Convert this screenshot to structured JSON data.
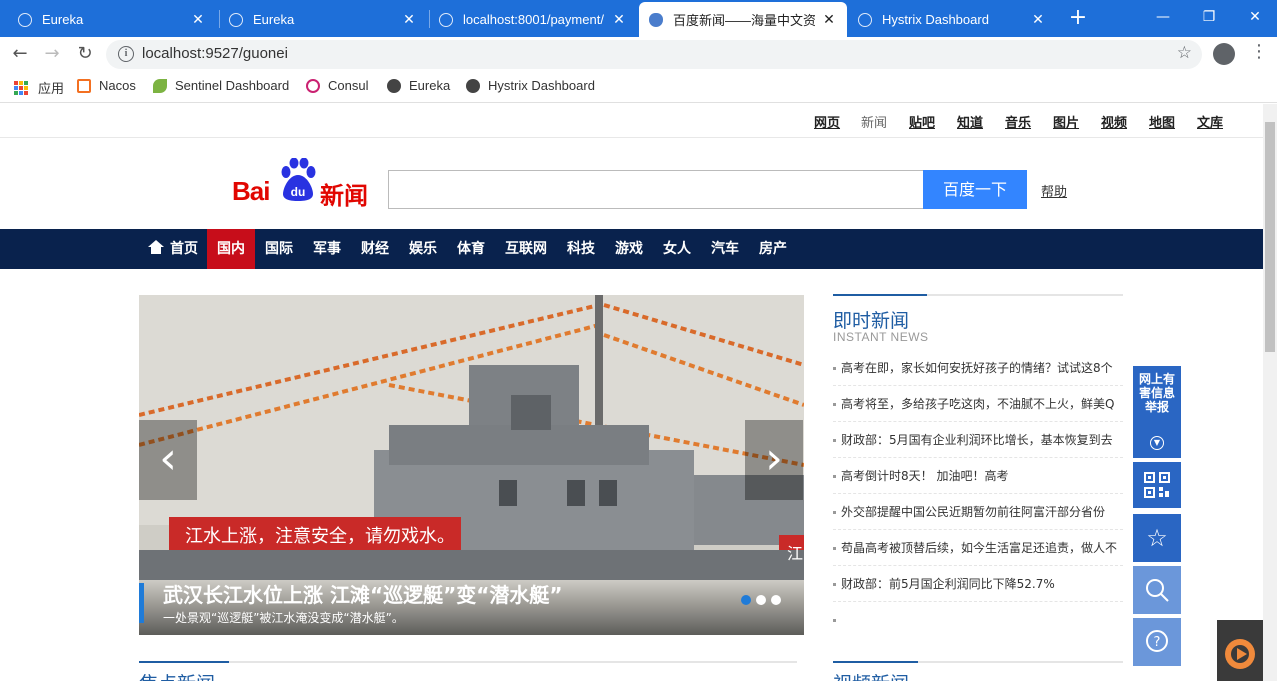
{
  "browser": {
    "tabs": [
      {
        "title": "Eureka",
        "active": false
      },
      {
        "title": "Eureka",
        "active": false
      },
      {
        "title": "localhost:8001/payment/",
        "active": false
      },
      {
        "title": "百度新闻——海量中文资讯",
        "active": true
      },
      {
        "title": "Hystrix Dashboard",
        "active": false
      }
    ],
    "close_glyph": "✕",
    "new_tab_glyph": "+",
    "window_controls": {
      "minimize": "—",
      "maximize": "❐",
      "close": "✕"
    },
    "url": "localhost:9527/guonei",
    "bookmarks": [
      "应用",
      "Nacos",
      "Sentinel Dashboard",
      "Consul",
      "Eureka",
      "Hystrix Dashboard"
    ]
  },
  "page": {
    "top_links": [
      "网页",
      "新闻",
      "贴吧",
      "知道",
      "音乐",
      "图片",
      "视频",
      "地图",
      "文库"
    ],
    "logo": {
      "bai": "Bai",
      "du": "du",
      "news": "新闻"
    },
    "search": {
      "value": "",
      "button": "百度一下",
      "help": "帮助"
    },
    "main_nav": [
      "首页",
      "国内",
      "国际",
      "军事",
      "财经",
      "娱乐",
      "体育",
      "互联网",
      "科技",
      "游戏",
      "女人",
      "汽车",
      "房产"
    ],
    "main_nav_active_index": 1,
    "slider": {
      "title": "武汉长江水位上涨 江滩“巡逻艇”变“潜水艇”",
      "subtitle": "一处景观“巡逻艇”被江水淹没变成“潜水艇”。",
      "banner_text": "江水上涨，注意安全，请勿戏水。",
      "banner_text_right": "江",
      "prev_glyph": "‹",
      "next_glyph": "›",
      "dots": 3,
      "active_dot": 0
    },
    "instant_news": {
      "title": "即时新闻",
      "subtitle": "INSTANT NEWS",
      "items": [
        "高考在即，家长如何安抚好孩子的情绪？试试这8个",
        "高考将至，多给孩子吃这肉，不油腻不上火，鲜美Q",
        "财政部：5月国有企业利润环比增长，基本恢复到去",
        "高考倒计时8天！ 加油吧！高考",
        "外交部提醒中国公民近期暂勿前往阿富汗部分省份",
        "苟晶高考被顶替后续，如今生活富足还追责，做人不",
        "财政部：前5月国企利润同比下降52.7%",
        ""
      ]
    },
    "sections": {
      "focus": "焦点新闻",
      "video": "视频新闻"
    },
    "float_toolbar": {
      "report": "网上有害信息举报"
    },
    "colors": {
      "tab_bar": "#1e6fd9",
      "nav_bg": "#09224d",
      "nav_active": "#c70d1a",
      "accent_blue": "#1f5da3",
      "search_button": "#3385ff",
      "logo_red": "#e10601"
    }
  }
}
